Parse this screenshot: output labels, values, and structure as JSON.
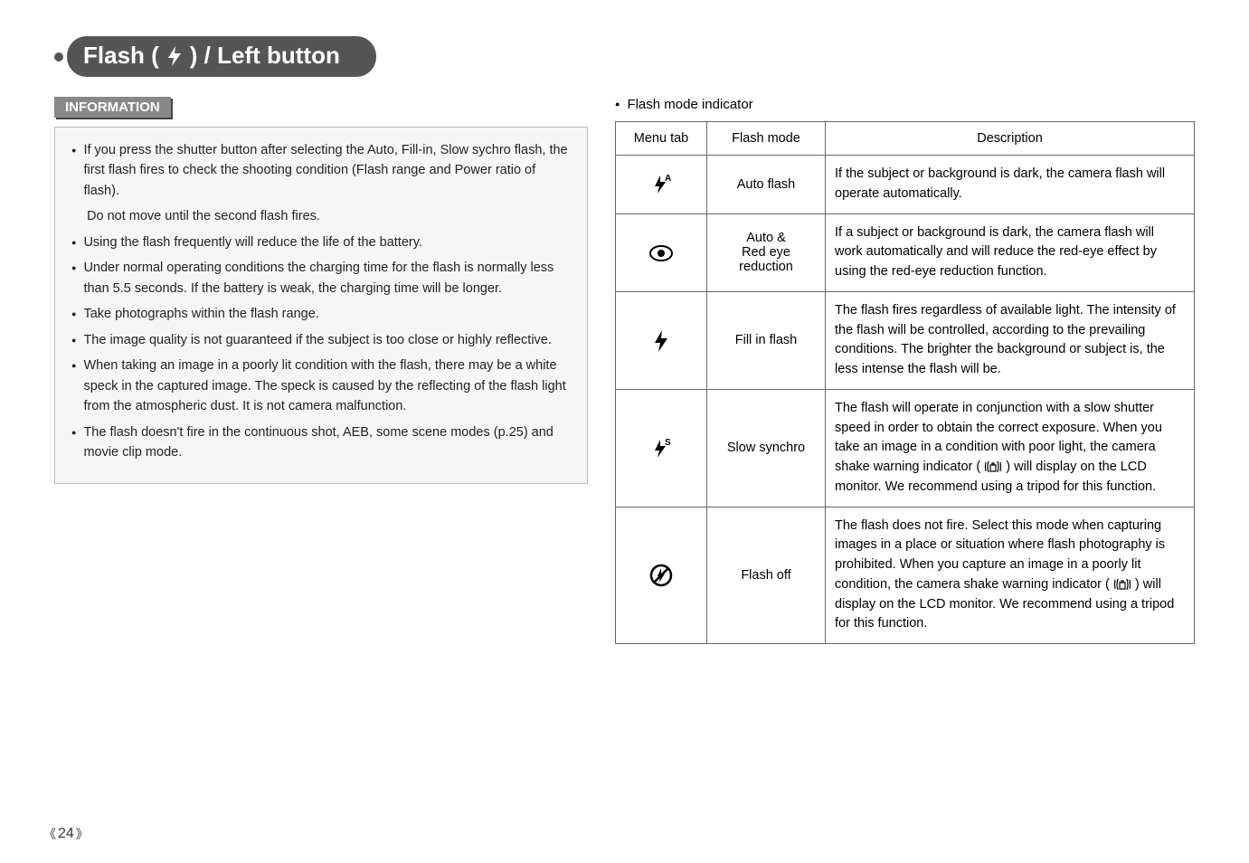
{
  "title": {
    "prefix": "Flash (",
    "suffix": ") / Left button"
  },
  "info": {
    "label": "INFORMATION",
    "items": [
      {
        "text": "If you press the shutter button after selecting the Auto, Fill-in, Slow sychro flash, the first flash fires to check the shooting condition (Flash range and Power ratio of flash).",
        "cont": "Do not move until the second flash fires."
      },
      {
        "text": "Using the flash frequently will reduce the life of the battery."
      },
      {
        "text": "Under normal operating conditions the charging time for the flash is normally less than 5.5 seconds. If the battery is weak, the charging time will be longer."
      },
      {
        "text": "Take photographs within the flash range."
      },
      {
        "text": "The image quality is not guaranteed if the subject is too close or highly reflective."
      },
      {
        "text": "When taking an image in a poorly lit condition with the flash, there may be a white speck in the captured image. The speck is caused by the reflecting of the flash light from the atmospheric dust. It is not camera malfunction."
      },
      {
        "text": "The flash doesn't fire in the continuous shot, AEB, some scene modes (p.25) and movie clip mode."
      }
    ]
  },
  "indicator_heading": "Flash mode indicator",
  "table": {
    "headers": {
      "menu_tab": "Menu tab",
      "flash_mode": "Flash mode",
      "description": "Description"
    },
    "rows": [
      {
        "icon": "auto-flash",
        "mode": "Auto flash",
        "desc": "If the subject or background is dark, the camera flash will operate automatically."
      },
      {
        "icon": "red-eye",
        "mode_lines": [
          "Auto &",
          "Red eye",
          "reduction"
        ],
        "desc": "If a subject or background is dark, the camera flash will work automatically and will reduce the red-eye effect by using the red-eye reduction function."
      },
      {
        "icon": "fill-flash",
        "mode": "Fill in flash",
        "desc": "The flash fires regardless of available light. The intensity of the flash will be controlled, according to the prevailing conditions. The brighter the background or subject is, the less intense the flash will be."
      },
      {
        "icon": "slow-sync",
        "mode": "Slow synchro",
        "desc_pre": "The flash will operate in conjunction with a slow shutter speed in order to obtain the correct exposure. When you take an image in a condition with poor light, the camera shake warning indicator ( ",
        "desc_post": " ) will display on the LCD monitor. We recommend using a tripod for this function."
      },
      {
        "icon": "flash-off",
        "mode": "Flash off",
        "desc_pre": "The flash does not fire. Select this mode when capturing images in a place or situation where flash photography is prohibited. When you capture an image in a poorly lit condition, the camera shake warning indicator ( ",
        "desc_post": " ) will display on the LCD monitor. We recommend using a tripod for this function."
      }
    ]
  },
  "page_number": "24"
}
